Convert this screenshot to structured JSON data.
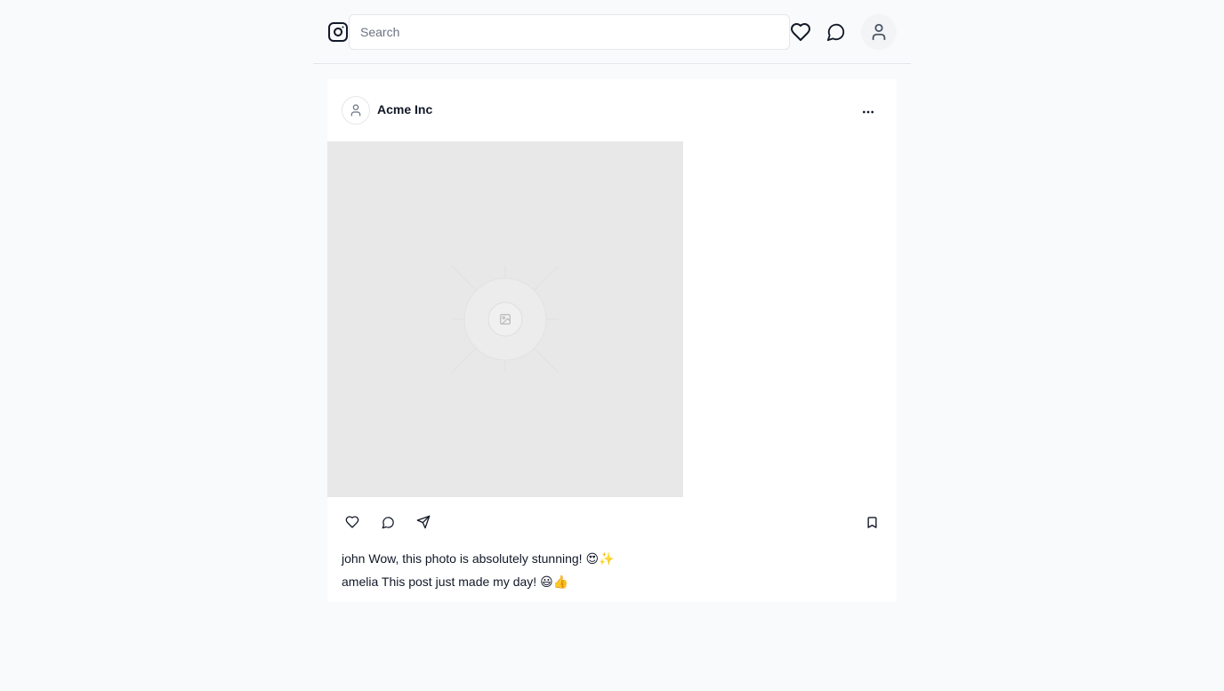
{
  "header": {
    "search_placeholder": "Search",
    "icons": {
      "logo": "instagram-icon",
      "notifications": "heart-icon",
      "messages": "chat-icon",
      "profile": "user-icon"
    }
  },
  "post": {
    "author": "Acme Inc",
    "image_placeholder_icon": "image-icon",
    "more_icon": "more-horizontal-icon",
    "actions": {
      "like": "heart-icon",
      "comment": "chat-icon",
      "share": "send-icon",
      "save": "bookmark-icon"
    },
    "comments": [
      {
        "user": "john",
        "text": "Wow, this photo is absolutely stunning! 😍✨"
      },
      {
        "user": "amelia",
        "text": "This post just made my day! 😃👍"
      }
    ]
  },
  "colors": {
    "page_background": "#f9fafb",
    "card_background": "#ffffff",
    "image_placeholder": "#e8e8e8",
    "text": "#111827",
    "muted_text": "#6b7280",
    "border": "#e5e7eb"
  }
}
